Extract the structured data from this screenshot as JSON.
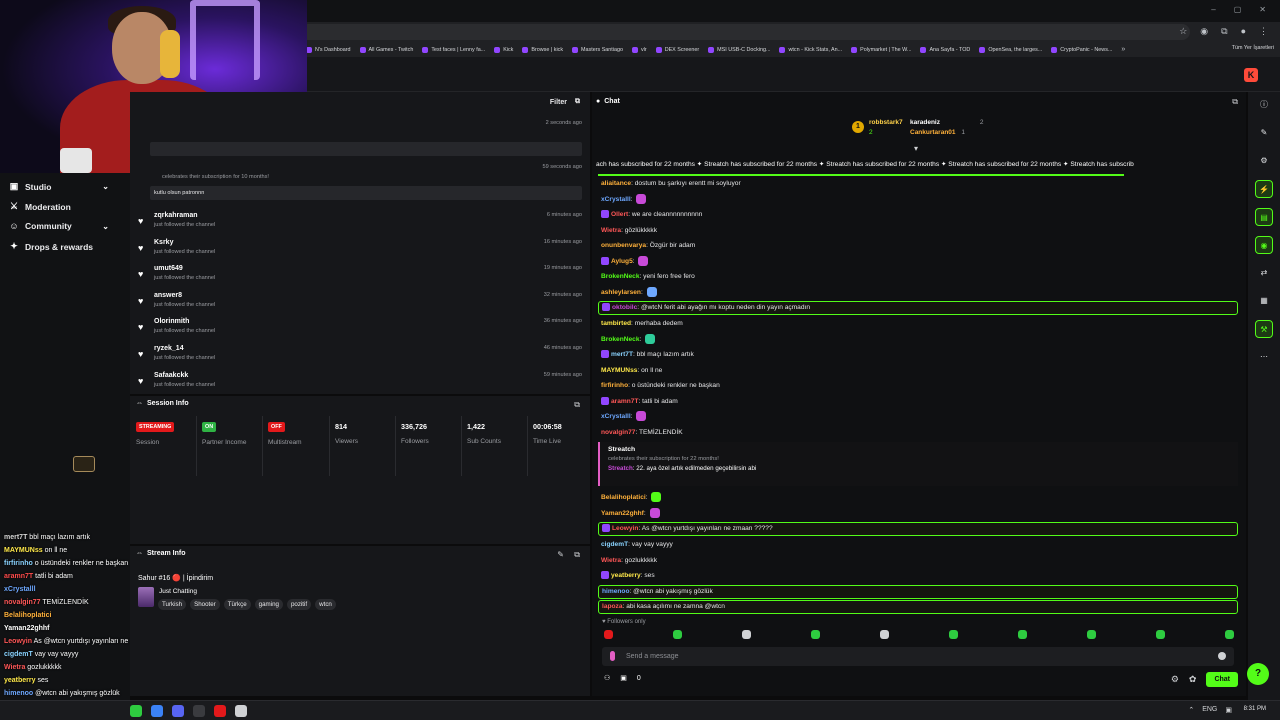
{
  "browser": {
    "bookmarks": [
      "N's Dashboard",
      "All Games - Twitch",
      "Test faces | Lenny fa...",
      "Kick",
      "Browse | kick",
      "Masters Santiago",
      "vlr",
      "DEX Screener",
      "MSI USB-C Docking...",
      "wtcn - Kick Stats, An...",
      "Polymarket | The W...",
      "Ana Sayfa - TOD",
      "OpenSea, the larges...",
      "CryptoPanic - News..."
    ],
    "bookmarks_more": "»",
    "bookmarks_folder": "Tüm Yer İşaretleri",
    "url_icons": [
      "☆",
      "◉",
      "⧉",
      "●",
      "⋮"
    ],
    "window_controls": [
      "–",
      "▢",
      "✕"
    ],
    "app_logo": "K"
  },
  "sidebar": {
    "items": [
      {
        "label": "Studio",
        "icon": "studio-icon",
        "glyph": "▣",
        "chevron": "⌄"
      },
      {
        "label": "Moderation",
        "icon": "sword-icon",
        "glyph": "⚔"
      },
      {
        "label": "Community",
        "icon": "users-icon",
        "glyph": "☺",
        "chevron": "⌄"
      },
      {
        "label": "Drops & rewards",
        "icon": "gift-icon",
        "glyph": "✦"
      }
    ]
  },
  "overlay_chat": [
    {
      "user": "mert7T",
      "text": "bbl maçı lazım artık",
      "color": "#d7d7d7"
    },
    {
      "user": "MAYMUNss",
      "text": "on ll ne",
      "color": "#ffe94a"
    },
    {
      "user": "firfirinho",
      "text": "o üstündeki renkler ne başkan",
      "color": "#8ad3ff"
    },
    {
      "user": "aramn7T",
      "text": "tatli bi adam",
      "color": "#ff4b4b"
    },
    {
      "user": "xCrystalll",
      "text": "",
      "color": "#6ea8ff"
    },
    {
      "user": "novalgin77",
      "text": "TEMİZLENDİK",
      "color": "#ff5757"
    },
    {
      "user": "Belalihoplatici",
      "text": "",
      "color": "#ffb13b"
    },
    {
      "user": "Yaman22ghhf",
      "text": "",
      "color": "#fff"
    },
    {
      "user": "Leowyin",
      "text": "As @wtcn yurtdışı yayınları ne zmaan ?????",
      "color": "#ff5757"
    },
    {
      "user": "cigdemT",
      "text": "vay vay vayyy",
      "color": "#8ad3ff"
    },
    {
      "user": "Wietra",
      "text": "gozlukkkkk",
      "color": "#ff5757"
    },
    {
      "user": "yeatberry",
      "text": "ses",
      "color": "#ffe94a"
    },
    {
      "user": "himenoo",
      "text": "@wtcn abi yakışmış gözlük",
      "color": "#6ea8ff"
    },
    {
      "user": "lapoza",
      "text": "abi kasa açılımı ne zamna @wtcn",
      "color": "#8ad3ff"
    }
  ],
  "feed": {
    "filter_label": "Filter",
    "rows_top": [
      {
        "time": "2 seconds ago"
      },
      {
        "time": "59 seconds ago",
        "sub": "celebrates their subscription for 10 months!",
        "message": "kutlu olsun patronnn"
      }
    ],
    "followers": [
      {
        "user": "zqrkahraman",
        "sub": "just followed the channel",
        "time": "6 minutes ago"
      },
      {
        "user": "Ksrky",
        "sub": "just followed the channel",
        "time": "16 minutes ago"
      },
      {
        "user": "umut649",
        "sub": "just followed the channel",
        "time": "19 minutes ago"
      },
      {
        "user": "answer8",
        "sub": "just followed the channel",
        "time": "32 minutes ago"
      },
      {
        "user": "Olorinmith",
        "sub": "just followed the channel",
        "time": "36 minutes ago"
      },
      {
        "user": "ryzek_14",
        "sub": "just followed the channel",
        "time": "46 minutes ago"
      },
      {
        "user": "Safaakckk",
        "sub": "just followed the channel",
        "time": "59 minutes ago"
      }
    ]
  },
  "session": {
    "title": "Session Info",
    "stats": [
      {
        "badge": "STREAMING",
        "badge_color": "#e3191b",
        "label": "Session"
      },
      {
        "badge": "ON",
        "badge_color": "#2fb344",
        "label": "Partner Income"
      },
      {
        "badge": "OFF",
        "badge_color": "#e3191b",
        "label": "Multistream"
      },
      {
        "value": "814",
        "label": "Viewers"
      },
      {
        "value": "336,726",
        "label": "Followers"
      },
      {
        "value": "1,422",
        "label": "Sub Counts"
      },
      {
        "value": "00:06:58",
        "label": "Time Live"
      }
    ]
  },
  "stream_info": {
    "title": "Stream Info",
    "stream_title": "Sahur #16 🔴 | İpindirim",
    "category": "Just Chatting",
    "tags": [
      "Turkish",
      "Shooter",
      "Türkçe",
      "gaming",
      "pozitif",
      "wtcn"
    ]
  },
  "chat": {
    "title": "Chat",
    "gifters": [
      {
        "rank": "1",
        "name": "robbstark7",
        "count": "2",
        "color": "#ffd24a"
      },
      {
        "name": "karadeniz",
        "count": "2",
        "color": "#fff"
      },
      {
        "name": "Cankurtaran01",
        "count": "1",
        "color": "#ffb13b"
      }
    ],
    "ticker": "ach has subscribed for 22 months ✦ Streatch has subscribed for 22 months ✦ Streatch has subscribed for 22 months ✦ Streatch has subscribed for 22 months ✦ Streatch has subscrib",
    "messages": [
      {
        "user": "aliaitance",
        "text": "dostum bu şarkıyı erentt mi soyluyor",
        "color": "#ffb13b"
      },
      {
        "user": "xCrystalll",
        "text": "",
        "color": "#6ea8ff",
        "emote": "#c84ad8"
      },
      {
        "user": "Ollert",
        "text": "we are cleannnnnnnnnn",
        "color": "#ff5757"
      },
      {
        "user": "Wietra",
        "text": "gözlükkkkk",
        "color": "#ff5757"
      },
      {
        "user": "onunbenvarya",
        "text": "Özgür bir adam",
        "color": "#ffb13b"
      },
      {
        "user": "Aylug5",
        "text": "",
        "color": "#ffb13b",
        "emote": "#c84ad8"
      },
      {
        "user": "BrokenNeck",
        "text": "yeni fero free fero",
        "color": "#53fc18"
      },
      {
        "user": "ashleylarsen",
        "text": "",
        "color": "#ffb13b",
        "emote": "#6ea8ff"
      },
      {
        "user": "oktobilc",
        "text": "@wtcN ferit abi ayağın mı koptu neden din yayın açmadın",
        "color": "#c84ad8",
        "highlight": true
      },
      {
        "user": "tambirted",
        "text": "merhaba dedem",
        "color": "#ffe94a"
      },
      {
        "user": "BrokenNeck",
        "text": "",
        "color": "#53fc18",
        "emote": "#2ecc9a"
      },
      {
        "user": "mert7T",
        "text": "bbl maçı lazım artık",
        "color": "#8ad3ff"
      },
      {
        "user": "MAYMUNss",
        "text": "on ll ne",
        "color": "#ffe94a"
      },
      {
        "user": "firfirinho",
        "text": "o üstündeki renkler ne başkan",
        "color": "#ffb13b"
      },
      {
        "user": "aramn7T",
        "text": "tatli bi adam",
        "color": "#ff5757"
      },
      {
        "user": "xCrystalll",
        "text": "",
        "color": "#6ea8ff",
        "emote": "#c84ad8"
      },
      {
        "user": "novalgin77",
        "text": "TEMİZLENDİK",
        "color": "#ff5757"
      }
    ],
    "subcard": {
      "user": "Streatch",
      "sub": "celebrates their subscription for 22 months!",
      "name": "Streatch",
      "message": "22. aya özel artık edilmeden geçebilirsin abi"
    },
    "messages_after": [
      {
        "user": "Belalihoplatici",
        "text": "",
        "color": "#ffb13b",
        "emote": "#53fc18"
      },
      {
        "user": "Yaman22ghhf",
        "text": "",
        "color": "#ffb13b",
        "emote": "#c84ad8"
      },
      {
        "user": "Leowyin",
        "text": "As @wtcn yurtdışı yayınları ne zmaan ?????",
        "color": "#ff5757",
        "highlight": true
      },
      {
        "user": "cigdemT",
        "text": "vay vay vayyy",
        "color": "#8ad3ff"
      },
      {
        "user": "Wietra",
        "text": "gozlukkkkk",
        "color": "#ff5757"
      },
      {
        "user": "yeatberry",
        "text": "ses",
        "color": "#ffe94a"
      },
      {
        "user": "himenoo",
        "text": "@wtcn abi yakışmış gözlük",
        "color": "#6ea8ff",
        "highlight": true
      },
      {
        "user": "lapoza",
        "text": "abi kasa açılımı ne zamna @wtcn",
        "color": "#ff5757",
        "highlight": true
      }
    ],
    "followers_only": "Followers only",
    "input_placeholder": "Send a message",
    "points": "0",
    "send_label": "Chat"
  },
  "rail_icons": [
    "ⓘ",
    "✎",
    "⚙",
    "⚡",
    "▤",
    "◉",
    "⇄",
    "▦",
    "⚒",
    "⋯"
  ],
  "taskbar": {
    "clock": "8:31 PM",
    "tray": [
      "⌃",
      "ENG",
      "▣"
    ]
  },
  "colors": {
    "accent": "#53fc18",
    "bg": "#0b0b0c",
    "panel": "#16171a"
  }
}
